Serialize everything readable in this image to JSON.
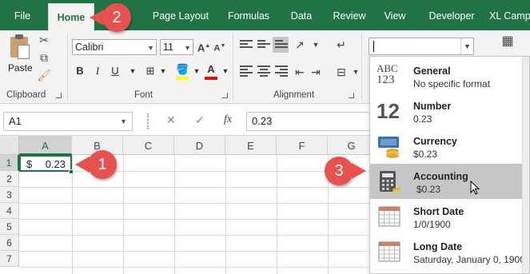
{
  "ribbon_tabs": [
    "File",
    "Home",
    "Page Layout",
    "Formulas",
    "Data",
    "Review",
    "View",
    "Developer",
    "XL Camp"
  ],
  "active_tab": "Home",
  "clipboard": {
    "paste_label": "Paste",
    "group_label": "Clipboard"
  },
  "font": {
    "name": "Calibri",
    "size": "11",
    "group_label": "Font",
    "bold": "B",
    "italic": "I",
    "underline": "U",
    "font_color_glyph": "A"
  },
  "alignment": {
    "group_label": "Alignment"
  },
  "number_format": {
    "current_value": ""
  },
  "formula_bar": {
    "name_box": "A1",
    "cancel": "✕",
    "enter": "✓",
    "fx": "fx",
    "formula": "0.23"
  },
  "grid": {
    "columns": [
      "A",
      "B",
      "C",
      "D",
      "E",
      "F",
      "G"
    ],
    "rows": [
      "1",
      "2",
      "3",
      "4",
      "5",
      "6",
      "7"
    ],
    "cell_a1": {
      "symbol": "$",
      "value": "0.23"
    }
  },
  "format_menu": [
    {
      "title": "General",
      "subtitle": "No specific format",
      "icon": "abc-123-icon"
    },
    {
      "title": "Number",
      "subtitle": "0.23",
      "icon": "number-12-icon"
    },
    {
      "title": "Currency",
      "subtitle": "$0.23",
      "icon": "currency-coins-icon"
    },
    {
      "title": "Accounting",
      "subtitle": "$0.23",
      "icon": "accounting-calculator-icon"
    },
    {
      "title": "Short Date",
      "subtitle": "1/0/1900",
      "icon": "calendar-icon"
    },
    {
      "title": "Long Date",
      "subtitle": "Saturday, January 0, 1900",
      "icon": "calendar-icon"
    }
  ],
  "general_icon_text": {
    "top": "ABC",
    "bottom": "123"
  },
  "number_icon_text": "12",
  "callouts": [
    "1",
    "2",
    "3"
  ],
  "colors": {
    "excel_green": "#217346",
    "callout_red": "#e8514d",
    "hover_gray": "#c6c6c6"
  }
}
